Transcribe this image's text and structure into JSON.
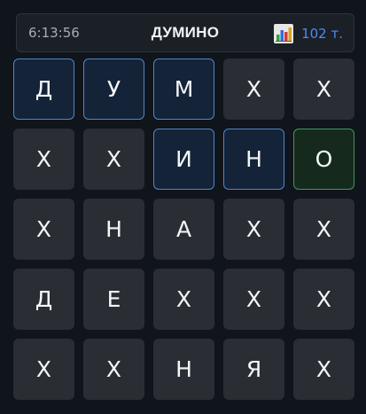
{
  "header": {
    "timer": "6:13:56",
    "title": "ДУМИНО",
    "stats_icon": "bar-chart-icon",
    "score": "102 т."
  },
  "colors": {
    "background": "#10141b",
    "tile": "#2a2d33",
    "selected_tile": "#142338",
    "selected_border": "#4f87c8",
    "correct_tile": "#152a1d",
    "correct_border": "#3f9a57",
    "score_text": "#4c8cf2"
  },
  "board": {
    "rows": [
      [
        {
          "letter": "Д",
          "state": "selected"
        },
        {
          "letter": "У",
          "state": "selected"
        },
        {
          "letter": "М",
          "state": "selected"
        },
        {
          "letter": "Х",
          "state": "normal"
        },
        {
          "letter": "Х",
          "state": "normal"
        }
      ],
      [
        {
          "letter": "Х",
          "state": "normal"
        },
        {
          "letter": "Х",
          "state": "normal"
        },
        {
          "letter": "И",
          "state": "selected"
        },
        {
          "letter": "Н",
          "state": "selected"
        },
        {
          "letter": "О",
          "state": "correct"
        }
      ],
      [
        {
          "letter": "Х",
          "state": "normal"
        },
        {
          "letter": "Н",
          "state": "normal"
        },
        {
          "letter": "А",
          "state": "normal"
        },
        {
          "letter": "Х",
          "state": "normal"
        },
        {
          "letter": "Х",
          "state": "normal"
        }
      ],
      [
        {
          "letter": "Д",
          "state": "normal"
        },
        {
          "letter": "Е",
          "state": "normal"
        },
        {
          "letter": "Х",
          "state": "normal"
        },
        {
          "letter": "Х",
          "state": "normal"
        },
        {
          "letter": "Х",
          "state": "normal"
        }
      ],
      [
        {
          "letter": "Х",
          "state": "normal"
        },
        {
          "letter": "Х",
          "state": "normal"
        },
        {
          "letter": "Н",
          "state": "normal"
        },
        {
          "letter": "Я",
          "state": "normal"
        },
        {
          "letter": "Х",
          "state": "normal"
        }
      ]
    ]
  }
}
